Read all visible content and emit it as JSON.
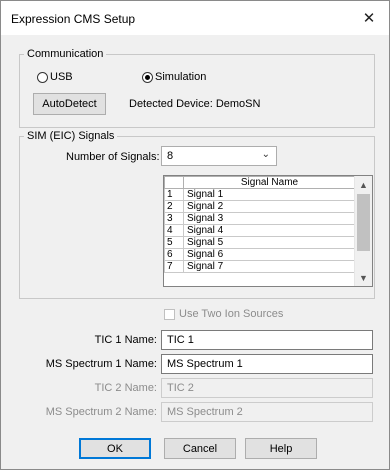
{
  "window": {
    "title": "Expression CMS Setup",
    "close_glyph": "✕"
  },
  "communication": {
    "legend": "Communication",
    "usb_label": "USB",
    "simulation_label": "Simulation",
    "selected": "Simulation",
    "autodetect_label": "AutoDetect",
    "detected_label": "Detected Device: DemoSN"
  },
  "sim": {
    "legend": "SIM (EIC) Signals",
    "num_signals_label": "Number of Signals:",
    "num_signals_value": "8",
    "table": {
      "header": "Signal Name",
      "rows": [
        {
          "idx": "1",
          "name": "Signal 1"
        },
        {
          "idx": "2",
          "name": "Signal 2"
        },
        {
          "idx": "3",
          "name": "Signal 3"
        },
        {
          "idx": "4",
          "name": "Signal 4"
        },
        {
          "idx": "5",
          "name": "Signal 5"
        },
        {
          "idx": "6",
          "name": "Signal 6"
        },
        {
          "idx": "7",
          "name": "Signal 7"
        }
      ]
    }
  },
  "ion": {
    "use_two_label": "Use Two Ion Sources",
    "checked": false
  },
  "fields": {
    "tic1_label": "TIC 1 Name:",
    "tic1_value": "TIC 1",
    "ms1_label": "MS Spectrum 1 Name:",
    "ms1_value": "MS Spectrum 1",
    "tic2_label": "TIC 2 Name:",
    "tic2_value": "TIC 2",
    "ms2_label": "MS Spectrum 2 Name:",
    "ms2_value": "MS Spectrum 2"
  },
  "buttons": {
    "ok": "OK",
    "cancel": "Cancel",
    "help": "Help"
  },
  "icons": {
    "close": "close-icon",
    "chevron": "chevron-down-icon",
    "scroll_up": "chevron-up-icon",
    "scroll_down": "chevron-down-icon"
  }
}
